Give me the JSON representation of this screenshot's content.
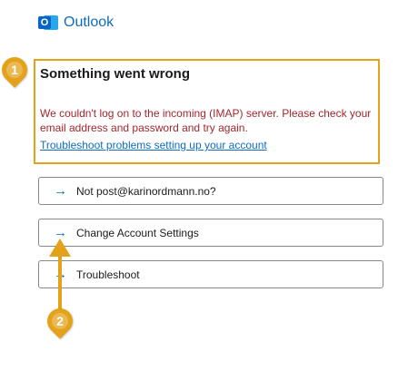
{
  "header": {
    "logo_letter": "O",
    "app_name": "Outlook"
  },
  "error": {
    "title": "Something went wrong",
    "message": "We couldn't log on to the incoming (IMAP) server. Please check your email address and password and try again.",
    "link": "Troubleshoot problems setting up your account"
  },
  "actions": [
    {
      "arrow": "→",
      "label": "Not post@karinordmann.no?"
    },
    {
      "arrow": "→",
      "label": "Change Account Settings"
    },
    {
      "arrow": "→",
      "label": "Troubleshoot"
    }
  ],
  "markers": {
    "first": "1",
    "second": "2"
  },
  "colors": {
    "accent": "#0f6cbd",
    "error": "#a4262c",
    "highlight": "#e3a21a"
  }
}
